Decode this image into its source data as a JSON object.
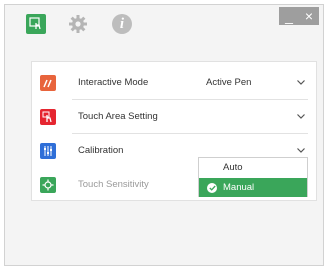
{
  "toolbar": {
    "touch_icon": "touch-icon",
    "settings_icon": "gear-icon",
    "info_icon": "info-icon",
    "info_glyph": "i",
    "accent": "#3aa65a"
  },
  "window_buttons": {
    "minimize": "_",
    "close": "×"
  },
  "settings": {
    "interactive_mode": {
      "label": "Interactive Mode",
      "value": "Active Pen",
      "icon": "pen-icon",
      "color": "#e8643c"
    },
    "touch_area": {
      "label": "Touch Area Setting",
      "icon": "touch-area-icon",
      "color": "#e52630"
    },
    "calibration": {
      "label": "Calibration",
      "icon": "calibration-icon",
      "color": "#2f6fd8"
    },
    "touch_sensitivity": {
      "label": "Touch Sensitivity",
      "icon": "sensitivity-icon",
      "color": "#3aa65a"
    }
  },
  "calibration_dropdown": {
    "options": [
      "Auto",
      "Manual"
    ],
    "selected": "Manual"
  }
}
